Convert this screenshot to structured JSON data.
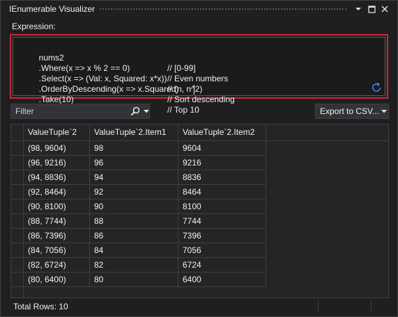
{
  "window": {
    "title": "IEnumerable Visualizer",
    "menu_icon": "chevron-down-icon",
    "maximize_icon": "maximize-icon",
    "close_icon": "close-icon"
  },
  "expression": {
    "label": "Expression:",
    "lines": [
      {
        "code": "nums2",
        "comment": "// [0-99]"
      },
      {
        "code": ".Where(x => x % 2 == 0)",
        "comment": "// Even numbers"
      },
      {
        "code": ".Select(x => (Val: x, Squared: x*x))",
        "comment": "// (n, n^2)"
      },
      {
        "code": ".OrderByDescending(x => x.Squared)",
        "comment": "// Sort descending"
      },
      {
        "code": ".Take(10)",
        "comment": "// Top 10"
      }
    ],
    "refresh_icon": "refresh-icon"
  },
  "filter": {
    "placeholder": "Filter",
    "search_icon": "search-icon"
  },
  "export": {
    "label": "Export to CSV..."
  },
  "grid": {
    "columns": [
      "ValueTuple`2",
      "ValueTuple`2.Item1",
      "ValueTuple`2.Item2"
    ],
    "rows": [
      [
        "(98, 9604)",
        "98",
        "9604"
      ],
      [
        "(96, 9216)",
        "96",
        "9216"
      ],
      [
        "(94, 8836)",
        "94",
        "8836"
      ],
      [
        "(92, 8464)",
        "92",
        "8464"
      ],
      [
        "(90, 8100)",
        "90",
        "8100"
      ],
      [
        "(88, 7744)",
        "88",
        "7744"
      ],
      [
        "(86, 7396)",
        "86",
        "7396"
      ],
      [
        "(84, 7056)",
        "84",
        "7056"
      ],
      [
        "(82, 6724)",
        "82",
        "6724"
      ],
      [
        "(80, 6400)",
        "80",
        "6400"
      ]
    ]
  },
  "status": {
    "total_rows": "Total Rows: 10"
  },
  "colors": {
    "highlight_border": "#c8283a",
    "background": "#1f1f1f",
    "refresh_icon": "#3794ff"
  }
}
